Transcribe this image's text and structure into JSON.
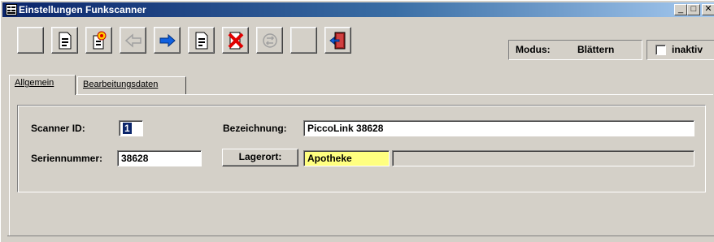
{
  "window": {
    "title": "Einstellungen Funkscanner"
  },
  "caption_buttons": {
    "minimize": "_",
    "maximize": "□",
    "close": "✕"
  },
  "toolbar": {
    "buttons": [
      {
        "name": "blank-button",
        "icon": "blank-icon",
        "enabled": false
      },
      {
        "name": "document-button",
        "icon": "document-icon",
        "enabled": true
      },
      {
        "name": "new-button",
        "icon": "new-document-star-icon",
        "enabled": true
      },
      {
        "name": "back-button",
        "icon": "arrow-left-icon",
        "enabled": false
      },
      {
        "name": "forward-button",
        "icon": "arrow-right-icon",
        "enabled": true
      },
      {
        "name": "edit-button",
        "icon": "edit-document-icon",
        "enabled": true
      },
      {
        "name": "delete-button",
        "icon": "delete-icon",
        "enabled": true
      },
      {
        "name": "refresh-button",
        "icon": "refresh-icon",
        "enabled": false
      },
      {
        "name": "blank2-button",
        "icon": "blank-icon",
        "enabled": false
      },
      {
        "name": "exit-button",
        "icon": "exit-door-icon",
        "enabled": true
      }
    ],
    "modus_label": "Modus:",
    "modus_value": "Blättern",
    "inaktiv_label": "inaktiv",
    "inaktiv_checked": false
  },
  "tabs": [
    {
      "label": "Allgemein",
      "active": true
    },
    {
      "label": "Bearbeitungsdaten",
      "active": false
    }
  ],
  "form": {
    "scanner_id_label": "Scanner ID:",
    "scanner_id_value": "1",
    "bezeichnung_label": "Bezeichnung:",
    "bezeichnung_value": "PiccoLink 38628",
    "seriennummer_label": "Seriennummer:",
    "seriennummer_value": "38628",
    "lagerort_button": "Lagerort:",
    "lagerort_value": "Apotheke",
    "lagerort_detail": ""
  },
  "colors": {
    "titlebar_start": "#0a246a",
    "titlebar_end": "#a6caf0",
    "face": "#d4d0c8",
    "lagerort_highlight": "#ffff80"
  }
}
